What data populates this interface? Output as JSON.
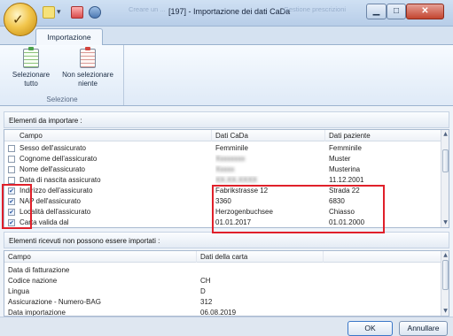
{
  "window": {
    "title": "[197] - Importazione dei dati CaDa",
    "ghost_titles": [
      "Creare un ...",
      "Gestione prescrizioni"
    ],
    "min_glyph": "▁",
    "max_glyph": "□",
    "close_glyph": "✕"
  },
  "ribbon": {
    "tab": "Importazione",
    "group_label": "Selezione",
    "buttons": [
      {
        "line1": "Selezionare",
        "line2": "tutto",
        "icon": "clipboard-check-icon"
      },
      {
        "line1": "Non selezionare",
        "line2": "niente",
        "icon": "clipboard-uncheck-icon"
      }
    ]
  },
  "import_section": {
    "label": "Elementi da importare :",
    "columns": [
      "Campo",
      "Dati CaDa",
      "Dati paziente"
    ],
    "rows": [
      {
        "checked": false,
        "field": "Sesso dell'assicurato",
        "cada": "Femminile",
        "patient": "Femminile",
        "cada_blurred": false
      },
      {
        "checked": false,
        "field": "Cognome dell'assicurato",
        "cada": "Xxxxxxxx",
        "patient": "Muster",
        "cada_blurred": true
      },
      {
        "checked": false,
        "field": "Nome dell'assicurato",
        "cada": "Xxxxx",
        "patient": "Musterina",
        "cada_blurred": true
      },
      {
        "checked": false,
        "field": "Data di nascita assicurato",
        "cada": "XX.XX.XXXX",
        "patient": "11.12.2001",
        "cada_blurred": true
      },
      {
        "checked": true,
        "field": "Indirizzo dell'assicurato",
        "cada": "Fabrikstrasse 12",
        "patient": "Strada 22",
        "cada_blurred": false
      },
      {
        "checked": true,
        "field": "NAP dell'assicurato",
        "cada": "3360",
        "patient": "6830",
        "cada_blurred": false
      },
      {
        "checked": true,
        "field": "Località dell'assicurato",
        "cada": "Herzogenbuchsee",
        "patient": "Chiasso",
        "cada_blurred": false
      },
      {
        "checked": true,
        "field": "Carta valida dal",
        "cada": "01.01.2017",
        "patient": "01.01.2000",
        "cada_blurred": false
      }
    ]
  },
  "not_imported_section": {
    "label": "Elementi ricevuti non possono essere importati :",
    "columns": [
      "Campo",
      "Dati della carta"
    ],
    "rows": [
      {
        "field": "Data di fatturazione",
        "value": ""
      },
      {
        "field": "Codice nazione",
        "value": "CH"
      },
      {
        "field": "Lingua",
        "value": "D"
      },
      {
        "field": "Assicurazione - Numero-BAG",
        "value": "312"
      },
      {
        "field": "Data importazione",
        "value": "06.08.2019"
      }
    ]
  },
  "footer": {
    "ok": "OK",
    "cancel": "Annullare"
  },
  "colors": {
    "highlight": "#e0202a",
    "accent": "#3b77c8"
  }
}
